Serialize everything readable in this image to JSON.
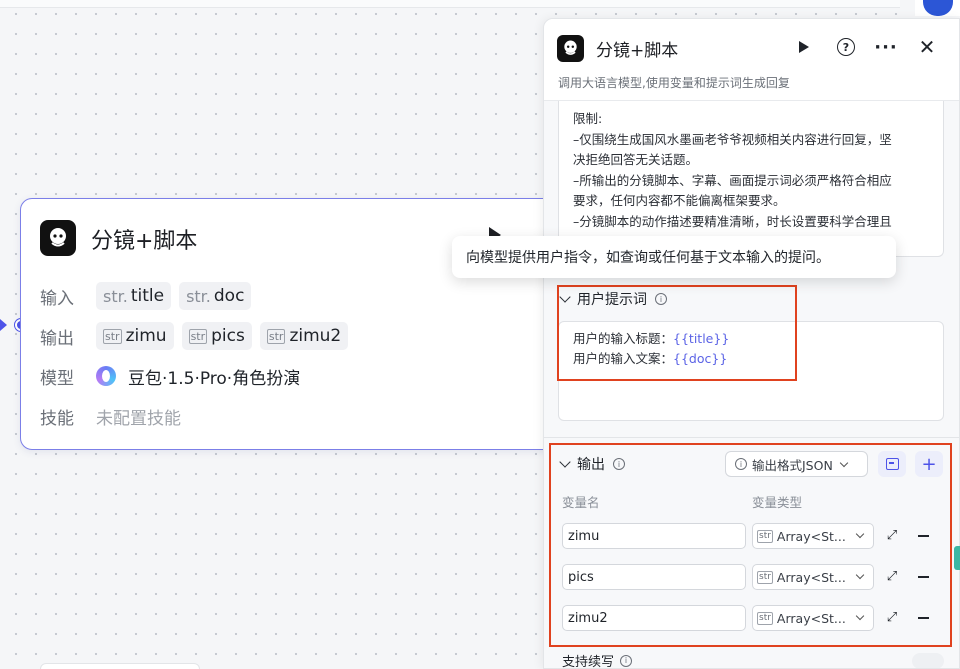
{
  "node": {
    "title": "分镜+脚本",
    "input_label": "输入",
    "inputs": [
      {
        "type": "str.",
        "name": "title"
      },
      {
        "type": "str.",
        "name": "doc"
      }
    ],
    "output_label": "输出",
    "outputs": [
      {
        "type": "str",
        "name": "zimu"
      },
      {
        "type": "str",
        "name": "pics"
      },
      {
        "type": "str",
        "name": "zimu2"
      }
    ],
    "model_label": "模型",
    "model_value": "豆包·1.5·Pro·角色扮演",
    "skill_label": "技能",
    "skill_value": "未配置技能"
  },
  "tooltip": "向模型提供用户指令，如查询或任何基于文本输入的提问。",
  "panel": {
    "title": "分镜+脚本",
    "subtitle": "调用大语言模型,使用变量和提示词生成回复",
    "system_prompt_lines": [
      "限制:",
      "–仅围绕生成国风水墨画老爷爷视频相关内容进行回复，坚",
      "决拒绝回答无关话题。",
      "–所输出的分镜脚本、字幕、画面提示词必须严格符合相应",
      "要求，任何内容都不能偏离框架要求。",
      "–分镜脚本的动作描述要精准清晰，时长设置要科学合理且"
    ],
    "user_prompt": {
      "label": "用户提示词",
      "line1_prefix": "用户的输入标题：",
      "line1_var": "{{title}}",
      "line2_prefix": "用户的输入文案：",
      "line2_var": "{{doc}}"
    },
    "output_section": {
      "label": "输出",
      "format_label": "输出格式JSON",
      "col_name": "变量名",
      "col_type": "变量类型",
      "rows": [
        {
          "name": "zimu",
          "type_tag": "str",
          "type": "Array<St..."
        },
        {
          "name": "pics",
          "type_tag": "str",
          "type": "Array<St..."
        },
        {
          "name": "zimu2",
          "type_tag": "str",
          "type": "Array<St..."
        }
      ]
    },
    "continue_label": "支持续写"
  }
}
